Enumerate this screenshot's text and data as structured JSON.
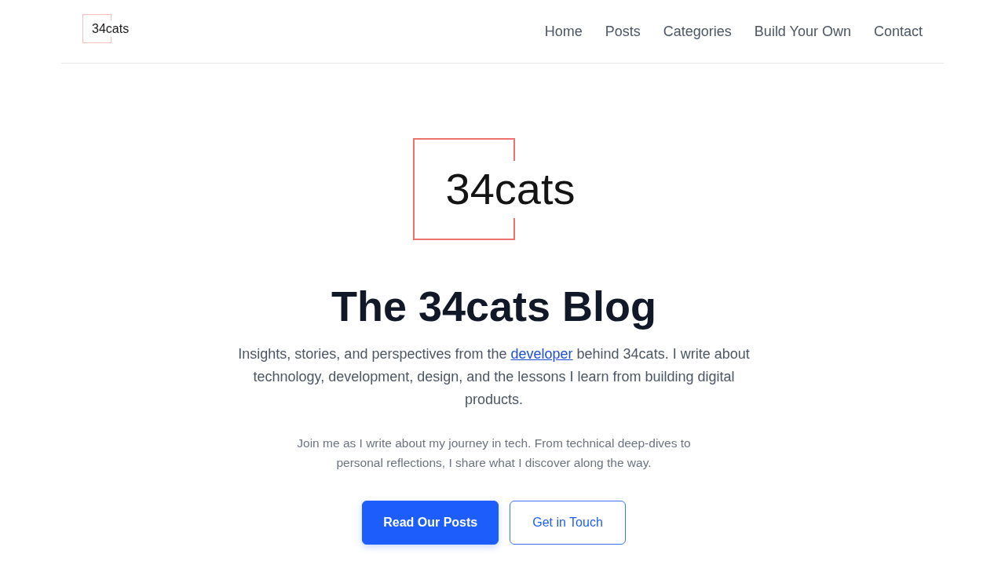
{
  "header": {
    "brand": "34cats",
    "nav_links": [
      "Home",
      "Posts",
      "Categories",
      "Build Your Own",
      "Contact"
    ]
  },
  "hero": {
    "logo_text": "34cats",
    "title": "The 34cats Blog",
    "intro": {
      "before": "Insights, stories, and perspectives from the ",
      "link": "developer",
      "after": " behind 34cats. I write about technology, development, design, and the lessons I learn from building digital products."
    },
    "subtext": "Join me as I write about my journey in tech. From technical deep-dives to personal reflections, I share what I discover along the way.",
    "buttons": [
      {
        "label": "Read Our Posts",
        "kind": "primary"
      },
      {
        "label": "Get in Touch",
        "kind": "outline"
      }
    ]
  }
}
